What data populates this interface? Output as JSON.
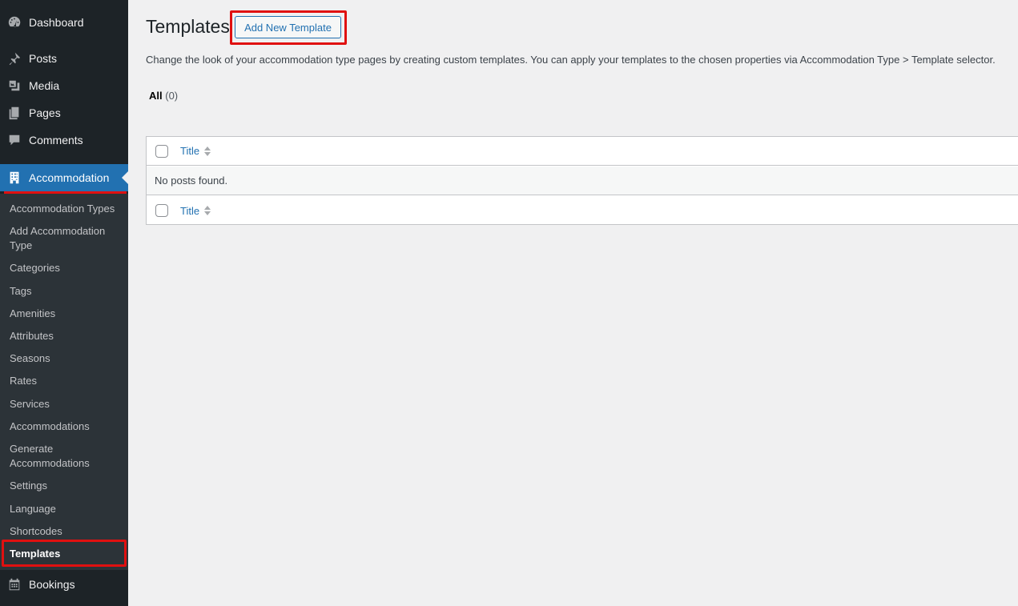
{
  "sidebar": {
    "top": [
      {
        "label": "Dashboard",
        "icon": "dashboard-icon"
      },
      {
        "label": "Posts",
        "icon": "pushpin-icon"
      },
      {
        "label": "Media",
        "icon": "media-icon"
      },
      {
        "label": "Pages",
        "icon": "pages-icon"
      },
      {
        "label": "Comments",
        "icon": "comment-icon"
      },
      {
        "label": "Accommodation",
        "icon": "building-icon"
      },
      {
        "label": "Bookings",
        "icon": "calendar-icon"
      }
    ],
    "submenu": [
      "Accommodation Types",
      "Add Accommodation Type",
      "Categories",
      "Tags",
      "Amenities",
      "Attributes",
      "Seasons",
      "Rates",
      "Services",
      "Accommodations",
      "Generate Accommodations",
      "Settings",
      "Language",
      "Shortcodes",
      "Templates"
    ],
    "current_submenu": "Templates"
  },
  "main": {
    "title": "Templates",
    "add_new_label": "Add New Template",
    "description": "Change the look of your accommodation type pages by creating custom templates. You can apply your templates to the chosen properties via Accommodation Type > Template selector.",
    "filter": {
      "all_label": "All",
      "all_count": "(0)"
    },
    "table": {
      "column_title": "Title",
      "empty_message": "No posts found."
    }
  },
  "colors": {
    "sidebar_bg": "#1d2327",
    "submenu_bg": "#2c3338",
    "accent": "#2271b1",
    "highlight_red": "#e01010"
  }
}
